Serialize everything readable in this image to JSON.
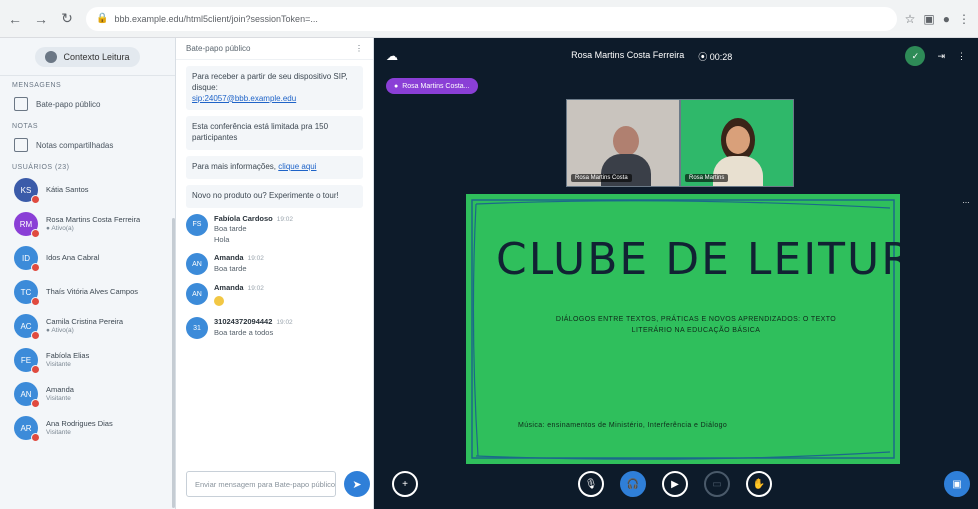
{
  "browser": {
    "url": "bbb.example.edu/html5client/join?sessionToken=...",
    "icons": [
      "back-icon",
      "forward-icon",
      "reload-icon"
    ]
  },
  "sidebar": {
    "user_label": "Contexto Leitura",
    "section_messages": "MENSAGENS",
    "public_chat": "Bate-papo público",
    "section_notes": "NOTAS",
    "shared_notes": "Notas compartilhadas",
    "section_users": "USUÁRIOS (23)",
    "users": [
      {
        "initials": "KS",
        "name": "Kátia Santos",
        "sub": "",
        "color": "#3b5ba9"
      },
      {
        "initials": "RM",
        "name": "Rosa Martins Costa Ferreira",
        "sub": "● Ativo(a)",
        "color": "#8a3fd6"
      },
      {
        "initials": "ID",
        "name": "Idos Ana Cabral",
        "sub": "",
        "color": "#3c8bd9"
      },
      {
        "initials": "TC",
        "name": "Thaís Vitória Alves Campos",
        "sub": "",
        "color": "#3c8bd9"
      },
      {
        "initials": "AC",
        "name": "Camila Cristina Pereira",
        "sub": "● Ativo(a)",
        "color": "#3c8bd9"
      },
      {
        "initials": "FE",
        "name": "Fabíola Elias",
        "sub": "Visitante",
        "color": "#3c8bd9"
      },
      {
        "initials": "AN",
        "name": "Amanda",
        "sub": "Visitante",
        "color": "#3c8bd9"
      },
      {
        "initials": "AR",
        "name": "Ana Rodrigues Dias",
        "sub": "Visitante",
        "color": "#3c8bd9"
      }
    ]
  },
  "chat": {
    "header": "Bate-papo público",
    "sys1": "Para receber a partir de seu dispositivo SIP, disque:",
    "sys1_link": "sip:24057@bbb.example.edu",
    "sys2": "Esta conferência está limitada pra 150 participantes",
    "sys3_a": "Para mais informações,",
    "sys3_link": "clique aqui",
    "sys4": "Novo no produto ou? Experimente o tour!",
    "messages": [
      {
        "initials": "FS",
        "name": "Fabíola Cardoso",
        "time": "19:02",
        "lines": [
          "Boa tarde",
          "Hola"
        ]
      },
      {
        "initials": "AN",
        "name": "Amanda",
        "time": "19:02",
        "lines": [
          "Boa tarde"
        ]
      },
      {
        "initials": "AN",
        "name": "Amanda",
        "time": "19:02",
        "lines": [
          ""
        ]
      },
      {
        "initials": "31",
        "name": "31024372094442",
        "time": "19:02",
        "lines": [
          "Boa tarde a todos"
        ]
      }
    ],
    "input_placeholder": "Enviar mensagem para Bate-papo público"
  },
  "meeting": {
    "title": "Rosa Martins Costa Ferreira",
    "timer": "00:28",
    "rec_label": "Rosa Martins Costa...",
    "video1_label": "Rosa Martins Costa",
    "video2_label": "Rosa Martins",
    "slide_title": "CLUBE DE LEITURA",
    "slide_sub1": "DIÁLOGOS ENTRE TEXTOS, PRÁTICAS E NOVOS APRENDIZADOS: O TEXTO",
    "slide_sub2": "LITERÁRIO NA EDUCAÇÃO BÁSICA",
    "slide_foot": "Música: ensinamentos de Ministério, Interferência e Diálogo",
    "side_label": "⋯"
  }
}
